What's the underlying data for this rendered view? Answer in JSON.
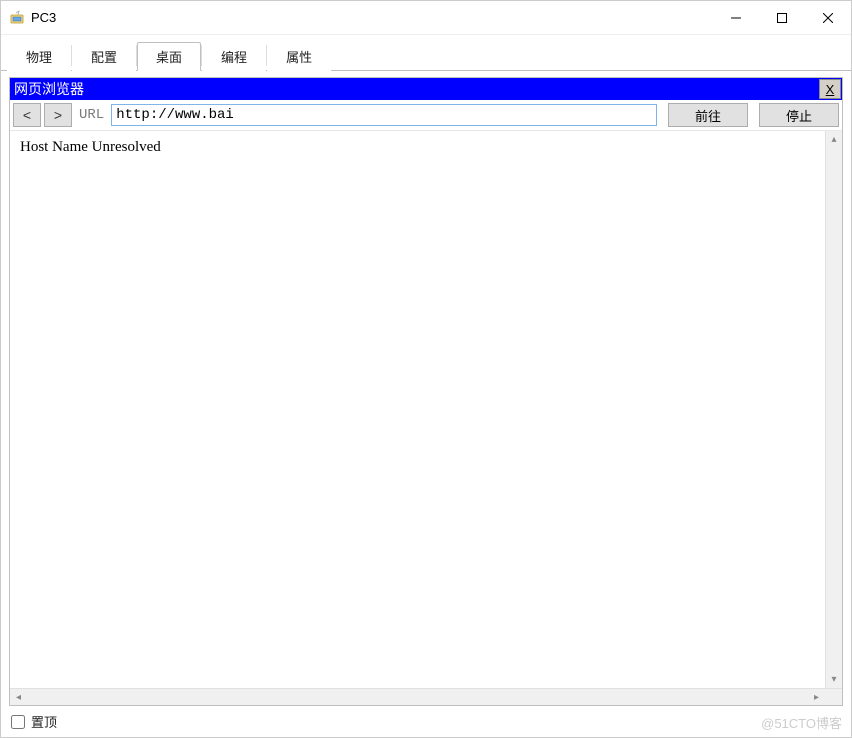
{
  "window": {
    "title": "PC3"
  },
  "tabs": {
    "items": [
      {
        "label": "物理",
        "active": false
      },
      {
        "label": "配置",
        "active": false
      },
      {
        "label": "桌面",
        "active": true
      },
      {
        "label": "编程",
        "active": false
      },
      {
        "label": "属性",
        "active": false
      }
    ]
  },
  "browser": {
    "header_title": "网页浏览器",
    "close_label": "X",
    "back_glyph": "<",
    "forward_glyph": ">",
    "url_label": "URL",
    "url_value": "http://www.bai",
    "go_label": "前往",
    "stop_label": "停止",
    "page_text": "Host Name Unresolved"
  },
  "footer": {
    "pin_label": "置顶",
    "pin_checked": false
  },
  "watermark": "@51CTO博客"
}
